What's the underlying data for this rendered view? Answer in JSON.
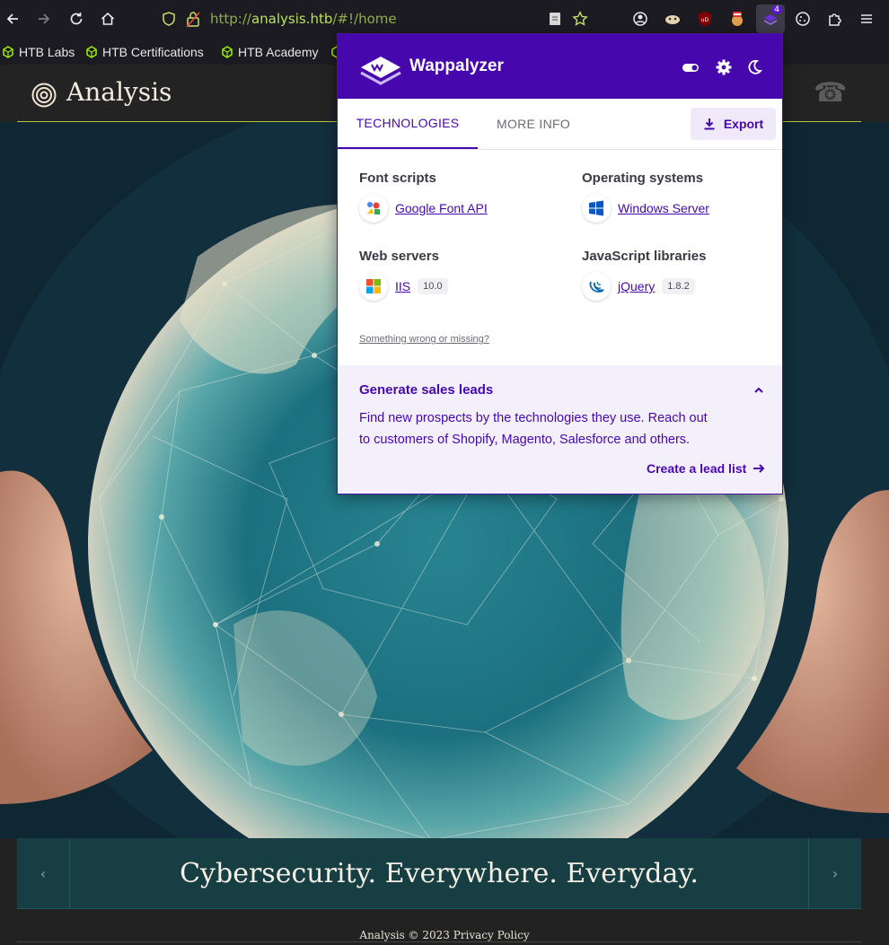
{
  "browser": {
    "url_host": "analysis.htb",
    "url_scheme": "http://",
    "url_path": "/#!/home",
    "extension_badge": "4",
    "bookmarks": [
      {
        "label": "HTB Labs",
        "icon": "hexagon-icon"
      },
      {
        "label": "HTB Certifications",
        "icon": "hexagon-icon"
      },
      {
        "label": "HTB Academy",
        "icon": "hexagon-icon"
      }
    ]
  },
  "site": {
    "title": "Analysis",
    "caption": "Cybersecurity. Everywhere. Everyday.",
    "footer": "Analysis © 2023 Privacy Policy",
    "accent": "#b7c93b",
    "caption_bg": "#173e42"
  },
  "wappalyzer": {
    "brand": "Wappalyzer",
    "tabs": {
      "technologies": "TECHNOLOGIES",
      "more_info": "MORE INFO"
    },
    "export_label": "Export",
    "categories": [
      {
        "name": "Font scripts",
        "tech": "Google Font API",
        "version": ""
      },
      {
        "name": "Operating systems",
        "tech": "Windows Server",
        "version": ""
      },
      {
        "name": "Web servers",
        "tech": "IIS",
        "version": "10.0"
      },
      {
        "name": "JavaScript libraries",
        "tech": "jQuery",
        "version": "1.8.2"
      }
    ],
    "missing_link": "Something wrong or missing?",
    "leads": {
      "title": "Generate sales leads",
      "text": "Find new prospects by the technologies they use. Reach out to customers of Shopify, Magento, Salesforce and others.",
      "link": "Create a lead list"
    },
    "brand_color": "#4608ad"
  }
}
